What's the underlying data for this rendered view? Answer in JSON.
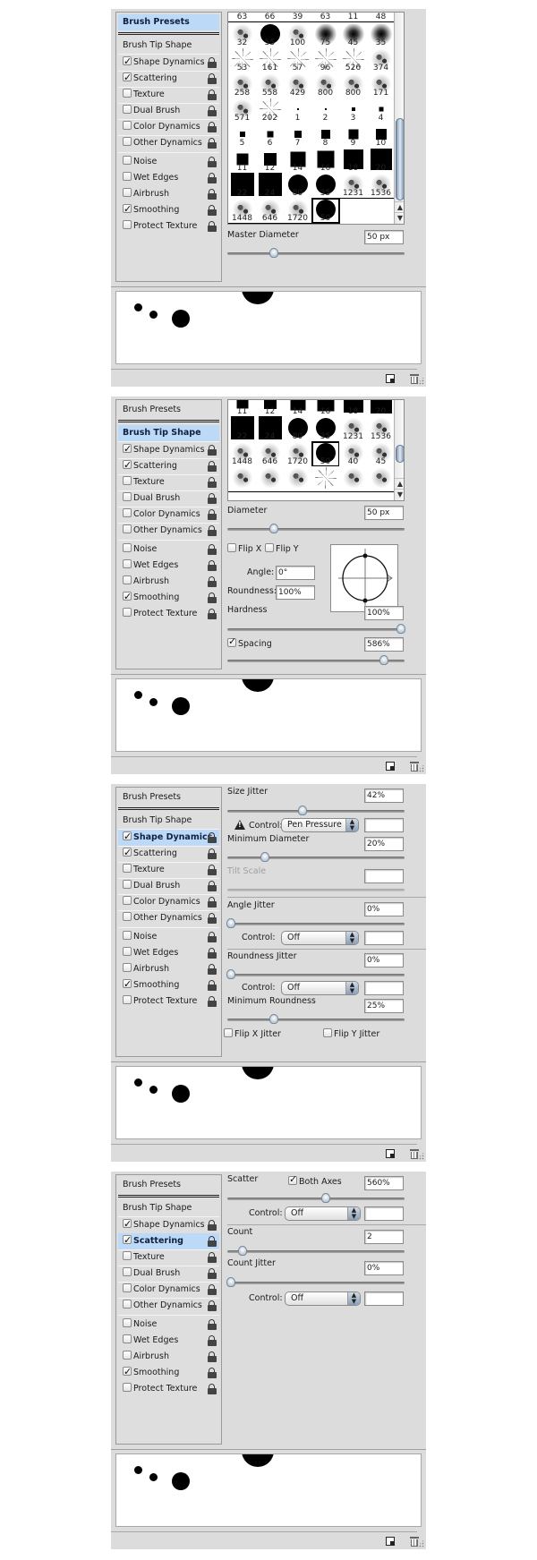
{
  "sidebar_labels": {
    "brush_presets": "Brush Presets",
    "brush_tip_shape": "Brush Tip Shape",
    "shape_dynamics": "Shape Dynamics",
    "scattering": "Scattering",
    "texture": "Texture",
    "dual_brush": "Dual Brush",
    "color_dynamics": "Color Dynamics",
    "other_dynamics": "Other Dynamics",
    "noise": "Noise",
    "wet_edges": "Wet Edges",
    "airbrush": "Airbrush",
    "smoothing": "Smoothing",
    "protect_texture": "Protect Texture"
  },
  "sidebar_checked": {
    "shape_dynamics": true,
    "scattering": true,
    "texture": false,
    "dual_brush": false,
    "color_dynamics": false,
    "other_dynamics": false,
    "noise": false,
    "wet_edges": false,
    "airbrush": false,
    "smoothing": true,
    "protect_texture": false
  },
  "panels": [
    {
      "active": "brush_presets",
      "brush_grid": {
        "top_partial_row": [
          "63",
          "66",
          "39",
          "63",
          "11",
          "48"
        ],
        "rows": [
          [
            {
              "n": "32",
              "t": "tex"
            },
            {
              "n": "55",
              "t": "round"
            },
            {
              "n": "100",
              "t": "tex"
            },
            {
              "n": "75",
              "t": "soft"
            },
            {
              "n": "45",
              "t": "soft"
            },
            {
              "n": "35",
              "t": "soft"
            }
          ],
          [
            {
              "n": "53",
              "t": "spark"
            },
            {
              "n": "161",
              "t": "spark"
            },
            {
              "n": "57",
              "t": "spark"
            },
            {
              "n": "96",
              "t": "spark"
            },
            {
              "n": "526",
              "t": "spark"
            },
            {
              "n": "374",
              "t": "tex"
            }
          ],
          [
            {
              "n": "258",
              "t": "tex"
            },
            {
              "n": "558",
              "t": "tex"
            },
            {
              "n": "429",
              "t": "tex"
            },
            {
              "n": "800",
              "t": "tex"
            },
            {
              "n": "800",
              "t": "tex"
            },
            {
              "n": "171",
              "t": "tex"
            }
          ],
          [
            {
              "n": "571",
              "t": "tex"
            },
            {
              "n": "202",
              "t": "spark"
            },
            {
              "n": "1",
              "t": "square"
            },
            {
              "n": "2",
              "t": "square"
            },
            {
              "n": "3",
              "t": "square"
            },
            {
              "n": "4",
              "t": "square"
            }
          ],
          [
            {
              "n": "5",
              "t": "square"
            },
            {
              "n": "6",
              "t": "square"
            },
            {
              "n": "7",
              "t": "square"
            },
            {
              "n": "8",
              "t": "square"
            },
            {
              "n": "9",
              "t": "square"
            },
            {
              "n": "10",
              "t": "square"
            }
          ],
          [
            {
              "n": "11",
              "t": "square"
            },
            {
              "n": "12",
              "t": "square"
            },
            {
              "n": "14",
              "t": "square"
            },
            {
              "n": "16",
              "t": "square"
            },
            {
              "n": "18",
              "t": "square"
            },
            {
              "n": "20",
              "t": "square"
            }
          ],
          [
            {
              "n": "22",
              "t": "square"
            },
            {
              "n": "24",
              "t": "square"
            },
            {
              "n": "80",
              "t": "round"
            },
            {
              "n": "35",
              "t": "round"
            },
            {
              "n": "1231",
              "t": "tex"
            },
            {
              "n": "1536",
              "t": "tex"
            }
          ],
          [
            {
              "n": "1448",
              "t": "tex"
            },
            {
              "n": "646",
              "t": "tex"
            },
            {
              "n": "1720",
              "t": "tex"
            },
            {
              "n": "50",
              "t": "round",
              "selected": true
            }
          ]
        ],
        "scroll_position": 0.85
      },
      "master_diameter": {
        "label": "Master Diameter",
        "value": "50 px",
        "slider": 0.25
      }
    },
    {
      "active": "brush_tip_shape",
      "brush_grid": {
        "rows": [
          [
            {
              "n": "11",
              "t": "square"
            },
            {
              "n": "12",
              "t": "square"
            },
            {
              "n": "14",
              "t": "square"
            },
            {
              "n": "16",
              "t": "square"
            },
            {
              "n": "18",
              "t": "square"
            },
            {
              "n": "20",
              "t": "square"
            }
          ],
          [
            {
              "n": "22",
              "t": "square"
            },
            {
              "n": "24",
              "t": "square"
            },
            {
              "n": "80",
              "t": "round"
            },
            {
              "n": "35",
              "t": "round"
            },
            {
              "n": "1231",
              "t": "tex"
            },
            {
              "n": "1536",
              "t": "tex"
            }
          ],
          [
            {
              "n": "1448",
              "t": "tex"
            },
            {
              "n": "646",
              "t": "tex"
            },
            {
              "n": "1720",
              "t": "tex"
            },
            {
              "n": "50",
              "t": "round",
              "selected": true
            },
            {
              "n": "40",
              "t": "tex"
            },
            {
              "n": "45",
              "t": "tex"
            }
          ],
          [
            {
              "n": "",
              "t": "tex"
            },
            {
              "n": "",
              "t": "tex"
            },
            {
              "n": "",
              "t": "tex"
            },
            {
              "n": "",
              "t": "spark"
            },
            {
              "n": "",
              "t": "tex"
            },
            {
              "n": "",
              "t": "tex"
            }
          ]
        ],
        "scroll_position": 0.6
      },
      "diameter": {
        "label": "Diameter",
        "value": "50 px",
        "slider": 0.25
      },
      "flip_x": {
        "label": "Flip X",
        "checked": false
      },
      "flip_y": {
        "label": "Flip Y",
        "checked": false
      },
      "angle": {
        "label": "Angle:",
        "value": "0°"
      },
      "roundness": {
        "label": "Roundness:",
        "value": "100%"
      },
      "hardness": {
        "label": "Hardness",
        "value": "100%",
        "slider": 1.0
      },
      "spacing": {
        "label": "Spacing",
        "checked": true,
        "value": "586%",
        "slider": 0.9
      }
    },
    {
      "active": "shape_dynamics",
      "size_jitter": {
        "label": "Size Jitter",
        "value": "42%",
        "slider": 0.42
      },
      "size_control": {
        "label": "Control:",
        "value": "Pen Pressure",
        "warning": true
      },
      "minimum_diameter": {
        "label": "Minimum Diameter",
        "value": "20%",
        "slider": 0.2
      },
      "tilt_scale": {
        "label": "Tilt Scale",
        "value": "",
        "disabled": true
      },
      "angle_jitter": {
        "label": "Angle Jitter",
        "value": "0%",
        "slider": 0.0
      },
      "angle_control": {
        "label": "Control:",
        "value": "Off"
      },
      "roundness_jitter": {
        "label": "Roundness Jitter",
        "value": "0%",
        "slider": 0.0
      },
      "roundness_control": {
        "label": "Control:",
        "value": "Off"
      },
      "minimum_roundness": {
        "label": "Minimum Roundness",
        "value": "25%",
        "slider": 0.25
      },
      "flip_x_jitter": {
        "label": "Flip X Jitter",
        "checked": false
      },
      "flip_y_jitter": {
        "label": "Flip Y Jitter",
        "checked": false
      }
    },
    {
      "active": "scattering",
      "scatter": {
        "label": "Scatter",
        "value": "560%",
        "slider": 0.56
      },
      "both_axes": {
        "label": "Both Axes",
        "checked": true
      },
      "scatter_control": {
        "label": "Control:",
        "value": "Off"
      },
      "count": {
        "label": "Count",
        "value": "2",
        "slider": 0.07
      },
      "count_jitter": {
        "label": "Count Jitter",
        "value": "0%",
        "slider": 0.0
      },
      "count_control": {
        "label": "Control:",
        "value": "Off"
      }
    }
  ],
  "footer": {
    "new_icon": "new-preset-icon",
    "trash_icon": "trash-icon",
    "grip_icon": "resize-grip-icon"
  }
}
